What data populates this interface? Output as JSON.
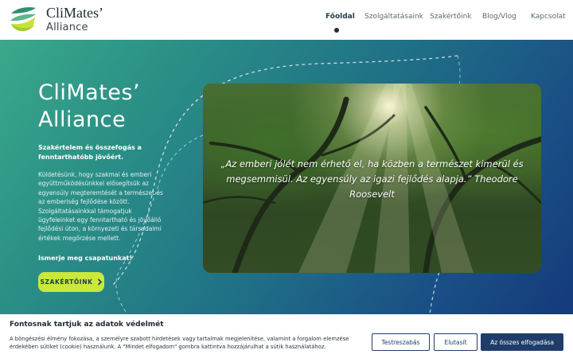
{
  "brand": {
    "name": "CliMates’",
    "sub": "Alliance"
  },
  "nav": {
    "items": [
      {
        "label": "Főoldal",
        "active": true
      },
      {
        "label": "Szolgáltatásaink",
        "active": false
      },
      {
        "label": "Szakértőink",
        "active": false
      },
      {
        "label": "Blog/Vlog",
        "active": false
      },
      {
        "label": "Kapcsolat",
        "active": false
      }
    ]
  },
  "hero": {
    "title_line1": "CliMates’",
    "title_line2": "Alliance",
    "tagline": "Szakértelem és összefogás a fenntarthatóbb jövőért.",
    "description": "Küldetésünk, hogy szakmai és emberi együttműködésünkkel elősegítsük az egyensúly megteremtését a természet és az emberiség fejlődése között. Szolgáltatásainkkal támogatjuk ügyfeleinket egy fenntartható és jövőálló fejlődési úton, a környezeti és társadalmi értékek megőrzése mellett.",
    "cta_text": "Ismerje meg csapatunkat!",
    "button_label": "SZAKÉRTŐINK",
    "button_icon": "chevron-right-icon",
    "quote": "„Az emberi jólét nem érhető el, ha közben a természet kimerül és megsemmisül. Az egyensúly az igazi fejlődés alapja.” Theodore Roosevelt"
  },
  "cookie": {
    "title": "Fontosnak tartjuk az adatok védelmét",
    "text": "A böngészési élmény fokozása, a személyre szabott hirdetések vagy tartalmak megjelenítése, valamint a forgalom elemzése érdekében sütiket (cookie) használunk. A \"Mindet elfogadom\" gombra kattintva hozzájárulhat a sütik használatához.",
    "customize_label": "Testreszabás",
    "reject_label": "Elutasít",
    "accept_label": "Az összes elfogadása"
  },
  "colors": {
    "accent": "#c9e83a",
    "button_dark": "#1f3d6b",
    "hero_start": "#3aa88a",
    "hero_end": "#143a7a"
  }
}
